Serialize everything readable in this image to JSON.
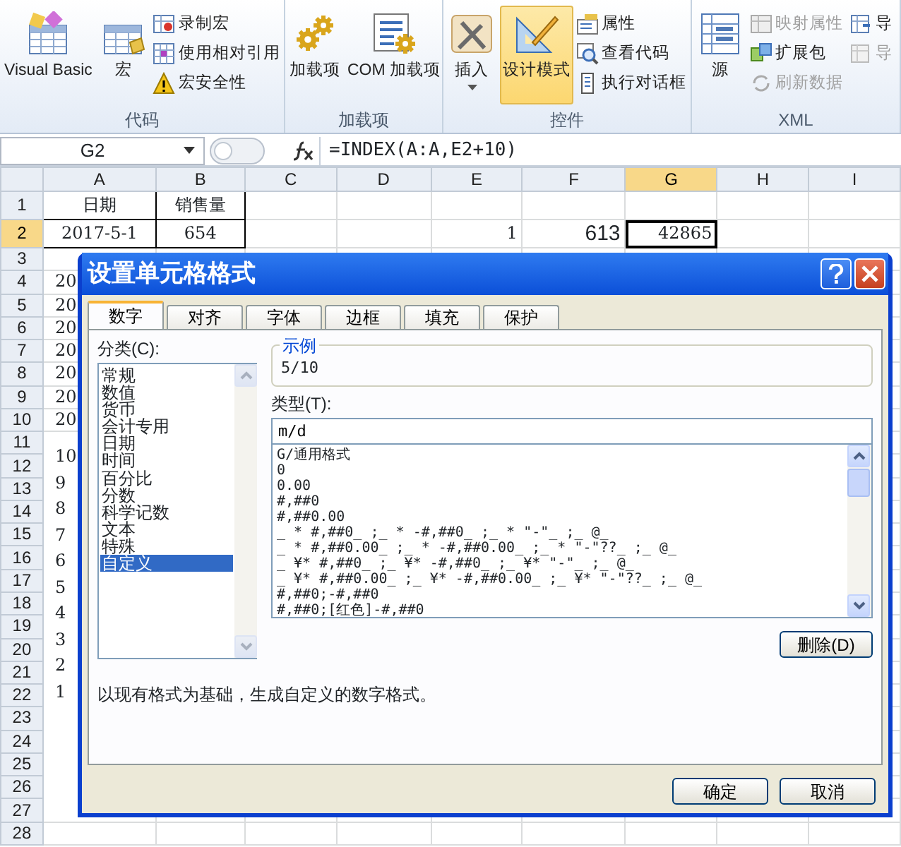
{
  "ribbon": {
    "groups": [
      {
        "label": "代码",
        "large": [
          {
            "label": "Visual Basic",
            "selected": false,
            "dropdown": false
          },
          {
            "label": "宏",
            "selected": false,
            "dropdown": false
          }
        ],
        "small": [
          {
            "label": "录制宏",
            "disabled": false
          },
          {
            "label": "使用相对引用",
            "disabled": false
          },
          {
            "label": "宏安全性",
            "disabled": false
          }
        ]
      },
      {
        "label": "加载项",
        "large": [
          {
            "label": "加载项",
            "selected": false,
            "dropdown": false
          },
          {
            "label": "COM 加载项",
            "selected": false,
            "dropdown": false
          }
        ]
      },
      {
        "label": "控件",
        "large": [
          {
            "label": "插入",
            "selected": false,
            "dropdown": true
          },
          {
            "label": "设计模式",
            "selected": true,
            "dropdown": false
          }
        ],
        "small": [
          {
            "label": "属性",
            "disabled": false
          },
          {
            "label": "查看代码",
            "disabled": false
          },
          {
            "label": "执行对话框",
            "disabled": false
          }
        ]
      },
      {
        "label": "XML",
        "large": [
          {
            "label": "源",
            "selected": false,
            "dropdown": false
          }
        ],
        "small": [
          {
            "label": "映射属性",
            "disabled": true
          },
          {
            "label": "扩展包",
            "disabled": false
          },
          {
            "label": "刷新数据",
            "disabled": true
          },
          {
            "label": "导",
            "disabled": false
          },
          {
            "label": "导",
            "disabled": true
          }
        ]
      }
    ]
  },
  "name_box": "G2",
  "formula": "=INDEX(A:A,E2+10)",
  "sheet": {
    "columns": [
      {
        "label": "A",
        "selected": false
      },
      {
        "label": "B",
        "selected": false
      },
      {
        "label": "C",
        "selected": false
      },
      {
        "label": "D",
        "selected": false
      },
      {
        "label": "E",
        "selected": false
      },
      {
        "label": "F",
        "selected": false
      },
      {
        "label": "G",
        "selected": true
      },
      {
        "label": "H",
        "selected": false
      },
      {
        "label": "I",
        "selected": false
      }
    ],
    "rows": [
      {
        "label": "1",
        "selected": false,
        "cells": {
          "A": {
            "text": "日期",
            "kind": "table",
            "selected": false
          },
          "B": {
            "text": "销售量",
            "kind": "table",
            "selected": false
          }
        }
      },
      {
        "label": "2",
        "selected": true,
        "cells": {
          "A": {
            "text": "2017-5-1",
            "kind": "table",
            "selected": false
          },
          "B": {
            "text": "654",
            "kind": "table",
            "selected": false
          },
          "E": {
            "text": "1",
            "kind": "value",
            "selected": false
          },
          "F": {
            "text": "613",
            "kind": "large",
            "selected": false
          },
          "G": {
            "text": "42865",
            "kind": "value",
            "selected": true
          }
        }
      },
      {
        "label": "3",
        "selected": false
      },
      {
        "label": "4",
        "selected": false,
        "cells": {
          "A": {
            "text": "20",
            "kind": "cut",
            "selected": false
          }
        }
      },
      {
        "label": "5",
        "selected": false,
        "cells": {
          "A": {
            "text": "20",
            "kind": "cut",
            "selected": false
          }
        }
      },
      {
        "label": "6",
        "selected": false,
        "cells": {
          "A": {
            "text": "20",
            "kind": "cut",
            "selected": false
          }
        }
      },
      {
        "label": "7",
        "selected": false,
        "cells": {
          "A": {
            "text": "20",
            "kind": "cut",
            "selected": false
          }
        }
      },
      {
        "label": "8",
        "selected": false,
        "cells": {
          "A": {
            "text": "20",
            "kind": "cut",
            "selected": false
          }
        }
      },
      {
        "label": "9",
        "selected": false,
        "cells": {
          "A": {
            "text": "20",
            "kind": "cut",
            "selected": false
          }
        }
      },
      {
        "label": "10",
        "selected": false,
        "cells": {
          "A": {
            "text": "20",
            "kind": "cut",
            "selected": false
          }
        }
      },
      {
        "label": "11",
        "selected": false
      },
      {
        "label": "12",
        "selected": false
      },
      {
        "label": "13",
        "selected": false
      },
      {
        "label": "14",
        "selected": false
      },
      {
        "label": "15",
        "selected": false
      },
      {
        "label": "16",
        "selected": false
      },
      {
        "label": "17",
        "selected": false
      },
      {
        "label": "18",
        "selected": false
      },
      {
        "label": "19",
        "selected": false
      },
      {
        "label": "20",
        "selected": false
      },
      {
        "label": "21",
        "selected": false
      },
      {
        "label": "22",
        "selected": false
      },
      {
        "label": "23",
        "selected": false
      },
      {
        "label": "24",
        "selected": false
      },
      {
        "label": "25",
        "selected": false
      },
      {
        "label": "26",
        "selected": false
      },
      {
        "label": "27",
        "selected": false
      },
      {
        "label": "28",
        "selected": false
      }
    ]
  },
  "chart": {
    "axis_labels": [
      "10",
      "9",
      "8",
      "7",
      "6",
      "5",
      "4",
      "3",
      "2",
      "1"
    ]
  },
  "dialog": {
    "title": "设置单元格格式",
    "tabs": [
      {
        "label": "数字",
        "selected": true
      },
      {
        "label": "对齐",
        "selected": false
      },
      {
        "label": "字体",
        "selected": false
      },
      {
        "label": "边框",
        "selected": false
      },
      {
        "label": "填充",
        "selected": false
      },
      {
        "label": "保护",
        "selected": false
      }
    ],
    "category": {
      "label": "分类(C):",
      "items": [
        {
          "label": "常规",
          "selected": false
        },
        {
          "label": "数值",
          "selected": false
        },
        {
          "label": "货币",
          "selected": false
        },
        {
          "label": "会计专用",
          "selected": false
        },
        {
          "label": "日期",
          "selected": false
        },
        {
          "label": "时间",
          "selected": false
        },
        {
          "label": "百分比",
          "selected": false
        },
        {
          "label": "分数",
          "selected": false
        },
        {
          "label": "科学记数",
          "selected": false
        },
        {
          "label": "文本",
          "selected": false
        },
        {
          "label": "特殊",
          "selected": false
        },
        {
          "label": "自定义",
          "selected": true
        }
      ]
    },
    "sample": {
      "legend": "示例",
      "value": "5/10"
    },
    "type": {
      "label": "类型(T):",
      "value": "m/d",
      "formats": [
        {
          "label": "G/通用格式",
          "selected": false
        },
        {
          "label": "0",
          "selected": false
        },
        {
          "label": "0.00",
          "selected": false
        },
        {
          "label": "#,##0",
          "selected": false
        },
        {
          "label": "#,##0.00",
          "selected": false
        },
        {
          "label": "_ * #,##0_ ;_ * -#,##0_ ;_ * \"-\"_ ;_ @_",
          "selected": false
        },
        {
          "label": "_ * #,##0.00_ ;_ * -#,##0.00_ ;_ * \"-\"??_ ;_ @_",
          "selected": false
        },
        {
          "label": "_ ¥* #,##0_ ;_ ¥* -#,##0_ ;_ ¥* \"-\"_ ;_ @_",
          "selected": false
        },
        {
          "label": "_ ¥* #,##0.00_ ;_ ¥* -#,##0.00_ ;_ ¥* \"-\"??_ ;_ @_",
          "selected": false
        },
        {
          "label": "#,##0;-#,##0",
          "selected": false
        },
        {
          "label": "#,##0;[红色]-#,##0",
          "selected": false
        }
      ]
    },
    "delete_button": "删除(D)",
    "description": "以现有格式为基础，生成自定义的数字格式。",
    "buttons": [
      "确定",
      "取消"
    ]
  }
}
